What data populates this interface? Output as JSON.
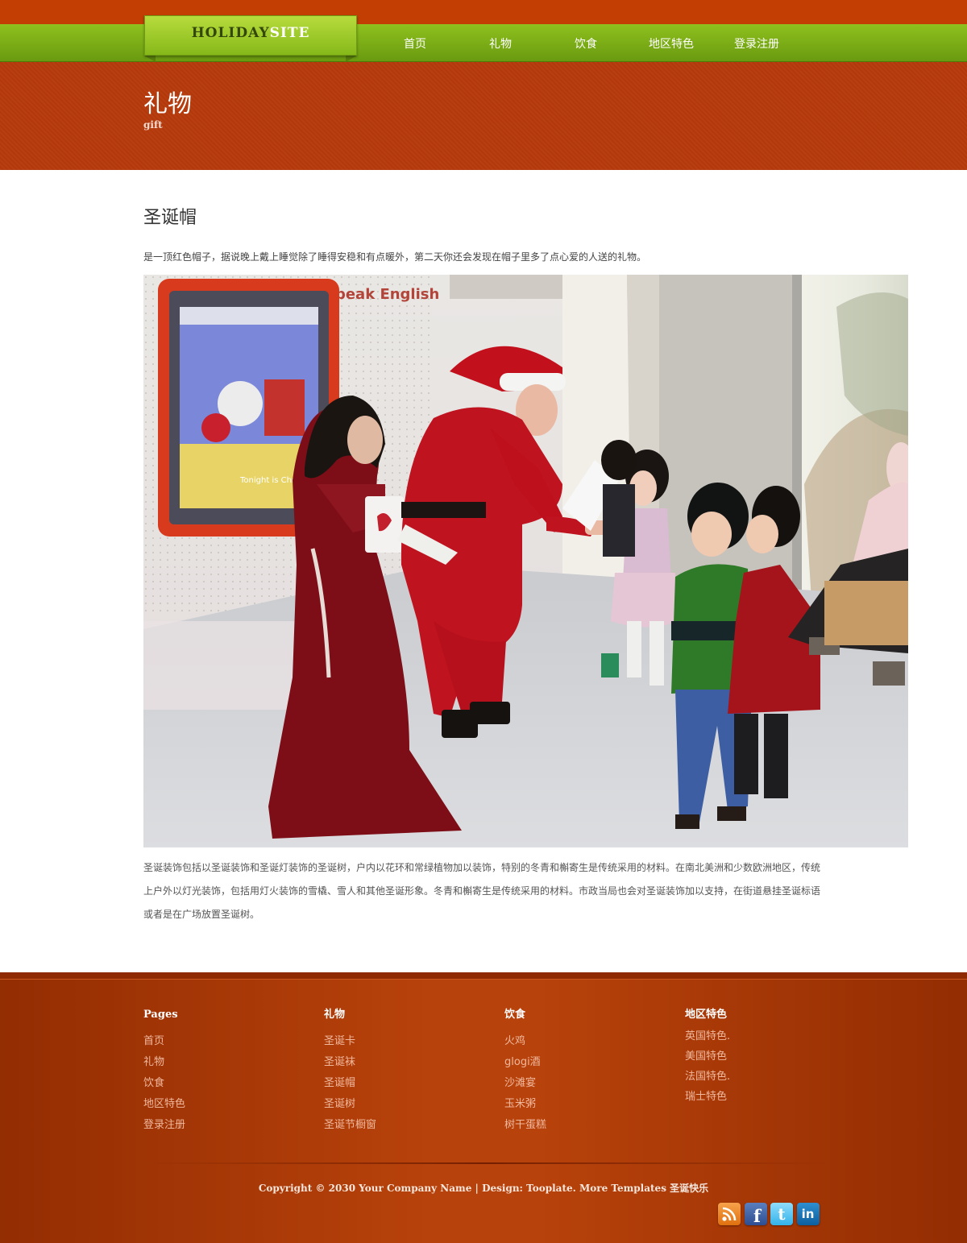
{
  "header": {
    "logo": {
      "part1": "HOLIDAY",
      "part2": "SITE"
    },
    "nav": [
      {
        "label": "首页"
      },
      {
        "label": "礼物"
      },
      {
        "label": "饮食"
      },
      {
        "label": "地区特色"
      },
      {
        "label": "登录注册"
      }
    ],
    "page_title": "礼物",
    "page_subtitle": "gift"
  },
  "content": {
    "section_title": "圣诞帽",
    "intro": "是一顶红色帽子，据说晚上戴上睡觉除了睡得安稳和有点暖外，第二天你还会发现在帽子里多了点心爱的人送的礼物。",
    "photo": {
      "screen_text": "Tonight is Christmas Eve",
      "wall_text": "Speak English"
    },
    "body": "圣诞装饰包括以圣诞装饰和圣诞灯装饰的圣诞树，户内以花环和常绿植物加以装饰，特别的冬青和槲寄生是传统采用的材料。在南北美洲和少数欧洲地区，传统上户外以灯光装饰，包括用灯火装饰的雪橇、雪人和其他圣诞形象。冬青和槲寄生是传统采用的材料。市政当局也会对圣诞装饰加以支持，在街道悬挂圣诞标语或者是在广场放置圣诞树。"
  },
  "footer": {
    "columns": [
      {
        "title": "Pages",
        "items": [
          "首页",
          "礼物",
          "饮食",
          "地区特色",
          "登录注册"
        ]
      },
      {
        "title": "礼物",
        "items": [
          "圣诞卡",
          "圣诞袜",
          "圣诞帽",
          "圣诞树",
          "圣诞节橱窗"
        ]
      },
      {
        "title": "饮食",
        "items": [
          "火鸡",
          "glogi酒",
          "沙滩宴",
          "玉米粥",
          "树干蛋糕"
        ]
      },
      {
        "title": "地区特色",
        "items": [
          "英国特色.",
          "美国特色",
          "法国特色.",
          "瑞士特色"
        ]
      }
    ],
    "copyright": "Copyright © 2030 Your Company Name | Design: Tooplate. More Templates 圣诞快乐",
    "social": [
      {
        "name": "rss-icon",
        "color": "#f18f2f"
      },
      {
        "name": "facebook-icon",
        "color": "#3b5998"
      },
      {
        "name": "twitter-icon",
        "color": "#55c2ef"
      },
      {
        "name": "linkedin-icon",
        "color": "#1a75b8"
      }
    ]
  }
}
